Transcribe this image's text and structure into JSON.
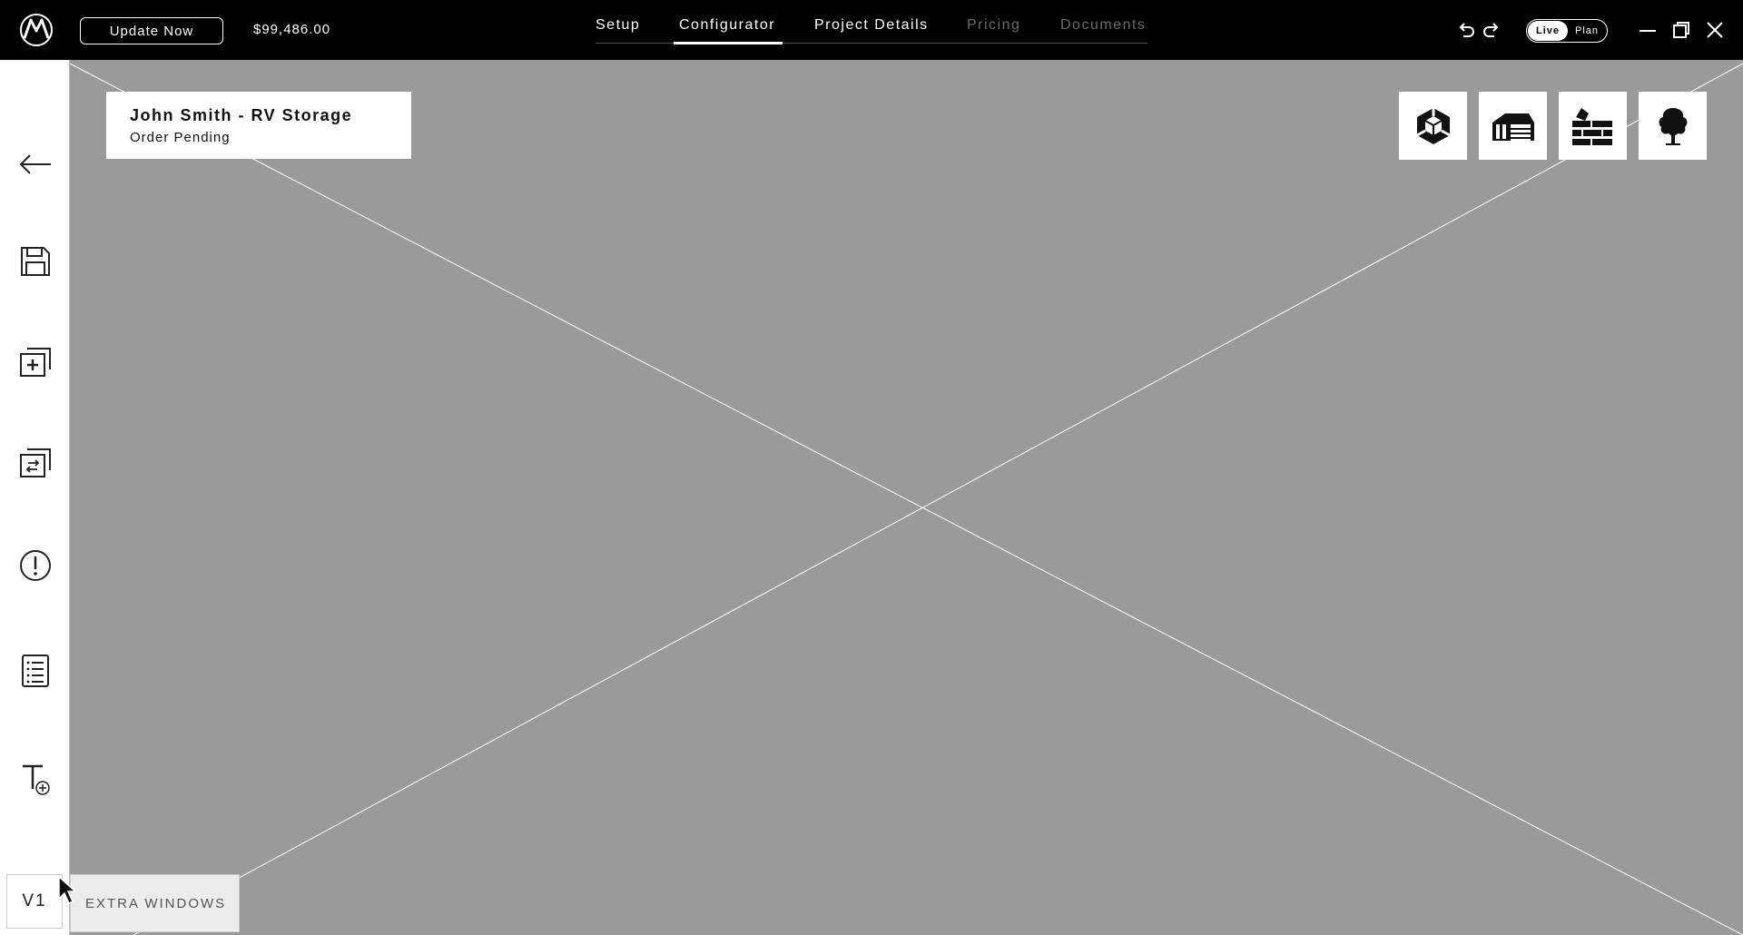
{
  "header": {
    "update_label": "Update Now",
    "price": "$99,486.00",
    "tabs": [
      {
        "label": "Setup",
        "active": false,
        "disabled": false
      },
      {
        "label": "Configurator",
        "active": true,
        "disabled": false
      },
      {
        "label": "Project Details",
        "active": false,
        "disabled": false
      },
      {
        "label": "Pricing",
        "active": false,
        "disabled": true
      },
      {
        "label": "Documents",
        "active": false,
        "disabled": true
      }
    ],
    "toggle": {
      "live_label": "Live",
      "plan_label": "Plan",
      "selected": "Live"
    }
  },
  "sidebar": {
    "items": [
      {
        "icon": "back-arrow-icon"
      },
      {
        "icon": "save-icon"
      },
      {
        "icon": "add-window-icon"
      },
      {
        "icon": "swap-window-icon"
      },
      {
        "icon": "alert-icon"
      },
      {
        "icon": "list-icon"
      },
      {
        "icon": "add-text-icon"
      }
    ],
    "version_label": "V1"
  },
  "project": {
    "title": "John Smith - RV Storage",
    "status": "Order Pending"
  },
  "tools": [
    {
      "icon": "cube-icon"
    },
    {
      "icon": "building-icon"
    },
    {
      "icon": "bricks-icon"
    },
    {
      "icon": "tree-icon"
    }
  ],
  "footer": {
    "extra_windows_label": "EXTRA WINDOWS"
  },
  "colors": {
    "topbar": "#000000",
    "canvas": "#9a9a9a",
    "panel": "#ffffff"
  }
}
